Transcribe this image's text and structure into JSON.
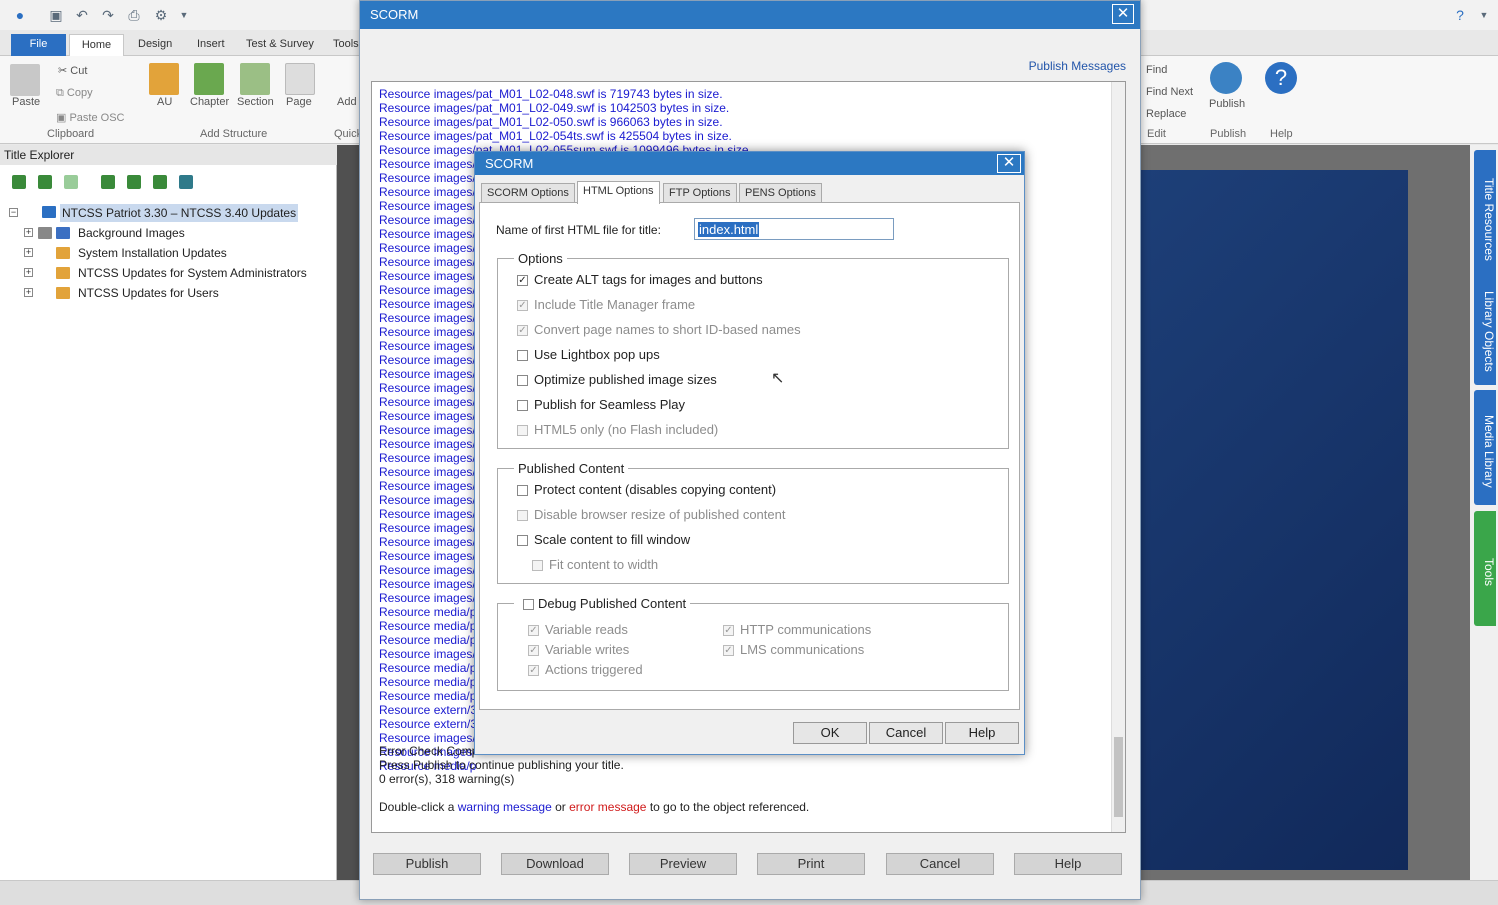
{
  "app": {
    "tabs": [
      "File",
      "Home",
      "Design",
      "Insert",
      "Test & Survey",
      "Tools"
    ],
    "ribbon": {
      "cut": "Cut",
      "copy": "Copy",
      "paste": "Paste",
      "paste_osc": "Paste OSC",
      "clipboard": "Clipboard",
      "au": "AU",
      "chapter": "Chapter",
      "section": "Section",
      "page": "Page",
      "add_structure": "Add Structure",
      "add": "Add",
      "quick": "Quick",
      "find": "Find",
      "find_next": "Find Next",
      "replace": "Replace",
      "edit": "Edit",
      "publish": "Publish",
      "publish_grp": "Publish",
      "help": "Help"
    }
  },
  "explorer": {
    "title": "Title Explorer",
    "root": "NTCSS Patriot 3.30 – NTCSS 3.40 Updates",
    "items": [
      "Background Images",
      "System Installation Updates",
      "NTCSS Updates for System Administrators",
      "NTCSS Updates for Users"
    ]
  },
  "side_tabs": [
    "Title Resources",
    "Library Objects",
    "Media Library",
    "Tools"
  ],
  "outer": {
    "title": "SCORM",
    "publish_messages": "Publish Messages",
    "log_lines": [
      "Resource images/pat_M01_L02-048.swf is 719743 bytes in size.",
      "Resource images/pat_M01_L02-049.swf is 1042503 bytes in size.",
      "Resource images/pat_M01_L02-050.swf is 966063 bytes in size.",
      "Resource images/pat_M01_L02-054ts.swf is 425504 bytes in size.",
      "Resource images/pat_M01_L02-055sum.swf is 1099496 bytes in size."
    ],
    "trunc_images": "Resource images/",
    "trunc_media": "Resource media/p",
    "trunc_extern": "Resource extern/3",
    "error_check": "Error Check Comp",
    "press_publish": "Press Publish to continue publishing your title.",
    "counts": "0 error(s), 318 warning(s)",
    "dbl_a": "Double-click a ",
    "warning_msg": "warning message",
    "dbl_or": " or ",
    "error_msg": "error message",
    "dbl_b": " to go to the object referenced.",
    "buttons": [
      "Publish",
      "Download",
      "Preview",
      "Print",
      "Cancel",
      "Help"
    ]
  },
  "inner": {
    "title": "SCORM",
    "tabs": [
      "SCORM Options",
      "HTML Options",
      "FTP Options",
      "PENS Options"
    ],
    "first_html_label": "Name of first HTML file for title:",
    "first_html_value": "index.html",
    "options_legend": "Options",
    "options": [
      {
        "label": "Create ALT tags for images and buttons",
        "checked": true,
        "disabled": false
      },
      {
        "label": "Include Title Manager frame",
        "checked": true,
        "disabled": true
      },
      {
        "label": "Convert page names to short ID-based names",
        "checked": true,
        "disabled": true
      },
      {
        "label": "Use Lightbox pop ups",
        "checked": false,
        "disabled": false
      },
      {
        "label": "Optimize published image sizes",
        "checked": false,
        "disabled": false
      },
      {
        "label": "Publish for Seamless Play",
        "checked": false,
        "disabled": false
      },
      {
        "label": "HTML5 only (no Flash included)",
        "checked": false,
        "disabled": true
      }
    ],
    "published_legend": "Published Content",
    "published": [
      {
        "label": "Protect content (disables copying content)",
        "checked": false,
        "disabled": false
      },
      {
        "label": "Disable browser resize of published content",
        "checked": false,
        "disabled": true
      },
      {
        "label": "Scale content to fill window",
        "checked": false,
        "disabled": false
      },
      {
        "label": "Fit content to width",
        "checked": false,
        "disabled": true
      }
    ],
    "debug_legend": "Debug Published Content",
    "debug": [
      {
        "label": "Variable reads",
        "checked": true
      },
      {
        "label": "HTTP communications",
        "checked": true
      },
      {
        "label": "Variable writes",
        "checked": true
      },
      {
        "label": "LMS communications",
        "checked": true
      },
      {
        "label": "Actions triggered",
        "checked": true
      }
    ],
    "buttons": {
      "ok": "OK",
      "cancel": "Cancel",
      "help": "Help"
    }
  }
}
